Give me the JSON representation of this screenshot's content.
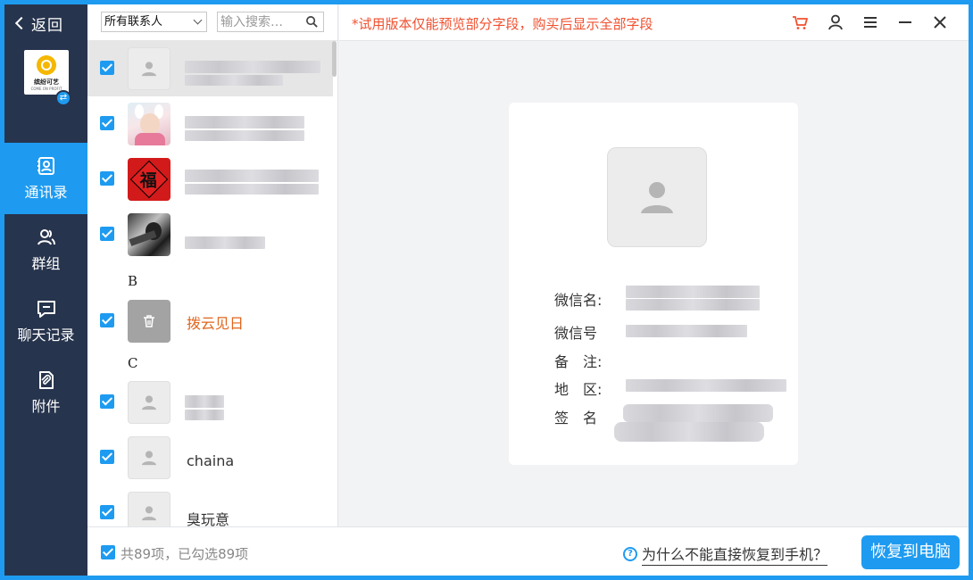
{
  "sidebar": {
    "back_label": "返回",
    "logo": {
      "line1": "缤纷可艺",
      "line2": "COME ON PROFIT"
    },
    "items": [
      {
        "label": "通讯录",
        "icon": "contacts-icon",
        "active": true
      },
      {
        "label": "群组",
        "icon": "group-icon",
        "active": false
      },
      {
        "label": "聊天记录",
        "icon": "chat-icon",
        "active": false
      },
      {
        "label": "附件",
        "icon": "attachment-icon",
        "active": false
      }
    ]
  },
  "filter": {
    "selected": "所有联系人",
    "search_placeholder": "输入搜索…"
  },
  "contacts": {
    "letters": [
      "B",
      "C"
    ],
    "named": [
      {
        "name": "拨云见日",
        "deleted": true
      },
      {
        "name": "chaina"
      },
      {
        "name": "臭玩意"
      }
    ]
  },
  "notice": "*试用版本仅能预览部分字段，购买后显示全部字段",
  "detail": {
    "labels": {
      "nickname": "微信名:",
      "wechat_id": "微信号",
      "remark": "备　注:",
      "region": "地　区:",
      "signature": "签　名"
    }
  },
  "footer": {
    "count_text": "共89项，已勾选89项",
    "help_text": "为什么不能直接恢复到手机？",
    "restore_label": "恢复到电脑"
  },
  "colors": {
    "accent": "#1e9bf0",
    "sidebar_bg": "#27344d",
    "notice": "#f0502f",
    "deleted_name": "#e0651c"
  }
}
